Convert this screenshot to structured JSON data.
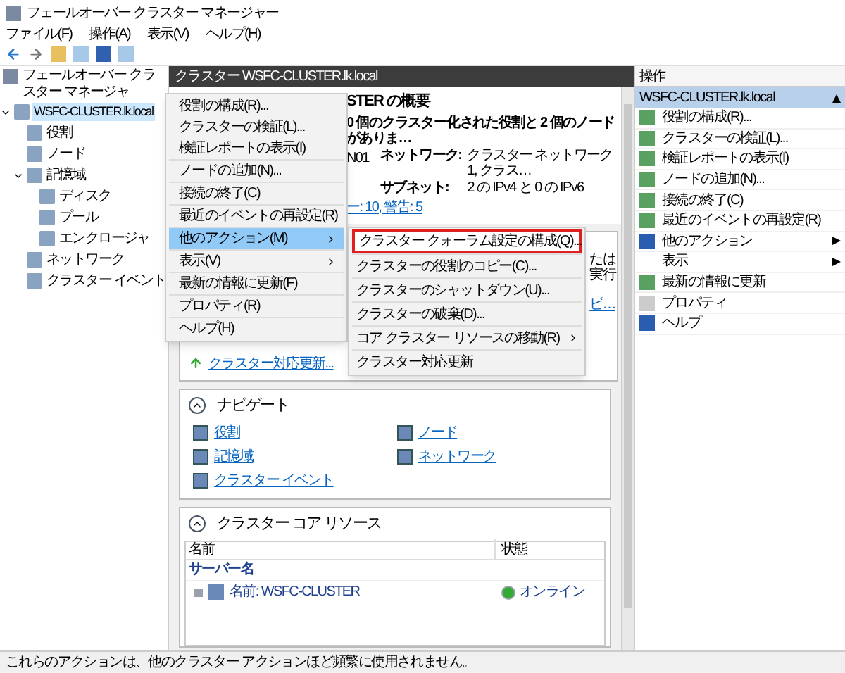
{
  "window": {
    "title": "フェールオーバー クラスター マネージャー"
  },
  "menu_bar": [
    "ファイル(F)",
    "操作(A)",
    "表示(V)",
    "ヘルプ(H)"
  ],
  "tree": {
    "root": "フェールオーバー クラスター マネージャ",
    "items": [
      {
        "label": "WSFC-CLUSTER.lk.local",
        "selected": true,
        "expanded": true,
        "children": [
          {
            "label": "役割",
            "selected": false
          },
          {
            "label": "ノード",
            "selected": false
          },
          {
            "label": "記憶域",
            "selected": false,
            "expanded": true,
            "children": [
              {
                "label": "ディスク",
                "selected": false
              },
              {
                "label": "プール",
                "selected": false
              },
              {
                "label": "エンクロージャ",
                "selected": false
              }
            ]
          },
          {
            "label": "ネットワーク",
            "selected": false
          },
          {
            "label": "クラスター イベント",
            "selected": false
          }
        ]
      }
    ]
  },
  "center": {
    "header": "クラスター WSFC-CLUSTER.lk.local",
    "summary": {
      "title_fragment": "STER の概要",
      "line": "0 個のクラスター化された役割と 2 個のノードがありま…",
      "network_label": "ネットワーク:",
      "network_value": "クラスター ネットワーク 1, クラス…",
      "node_fragment": "N01",
      "subnet_label": "サブネット:",
      "subnet_value": "2 の IPv4 と 0 の IPv6",
      "events_link": "ー: 10, 警告: 5"
    },
    "config_box": {
      "fragment_1": "たは",
      "fragment_2": "実行",
      "link_fragment": "ビ…",
      "update_link": "クラスター対応更新..."
    },
    "navigate": {
      "title": "ナビゲート",
      "expanded": true,
      "links": [
        "役割",
        "ノード",
        "記憶域",
        "ネットワーク",
        "クラスター イベント"
      ]
    },
    "core": {
      "title": "クラスター コア リソース",
      "expanded": true,
      "columns": [
        "名前",
        "状態"
      ],
      "group": "サーバー名",
      "rows": [
        {
          "name": "名前: WSFC-CLUSTER",
          "status": "オンライン"
        }
      ]
    }
  },
  "actions": {
    "title": "操作",
    "section": "WSFC-CLUSTER.lk.local",
    "expanded": true,
    "items": [
      {
        "label": "役割の構成(R)...",
        "submenu": false
      },
      {
        "label": "クラスターの検証(L)...",
        "submenu": false
      },
      {
        "label": "検証レポートの表示(I)",
        "submenu": false
      },
      {
        "label": "ノードの追加(N)...",
        "submenu": false
      },
      {
        "label": "接続の終了(C)",
        "submenu": false
      },
      {
        "label": "最近のイベントの再設定(R)",
        "submenu": false
      },
      {
        "label": "他のアクション",
        "submenu": true
      },
      {
        "label": "表示",
        "submenu": true
      },
      {
        "label": "最新の情報に更新",
        "submenu": false
      },
      {
        "label": "プロパティ",
        "submenu": false
      },
      {
        "label": "ヘルプ",
        "submenu": false
      }
    ]
  },
  "context_menu": {
    "groups": [
      [
        {
          "label": "役割の構成(R)...",
          "selected": false,
          "submenu": false
        },
        {
          "label": "クラスターの検証(L)...",
          "selected": false,
          "submenu": false
        },
        {
          "label": "検証レポートの表示(I)",
          "selected": false,
          "submenu": false
        }
      ],
      [
        {
          "label": "ノードの追加(N)...",
          "selected": false,
          "submenu": false
        }
      ],
      [
        {
          "label": "接続の終了(C)",
          "selected": false,
          "submenu": false
        }
      ],
      [
        {
          "label": "最近のイベントの再設定(R)",
          "selected": false,
          "submenu": false
        }
      ],
      [
        {
          "label": "他のアクション(M)",
          "selected": true,
          "submenu": true
        }
      ],
      [
        {
          "label": "表示(V)",
          "selected": false,
          "submenu": true
        }
      ],
      [
        {
          "label": "最新の情報に更新(F)",
          "selected": false,
          "submenu": false
        }
      ],
      [
        {
          "label": "プロパティ(R)",
          "selected": false,
          "submenu": false
        }
      ],
      [
        {
          "label": "ヘルプ(H)",
          "selected": false,
          "submenu": false
        }
      ]
    ]
  },
  "submenu": {
    "items": [
      {
        "label": "クラスター クォーラム設定の構成(Q)...",
        "outlined": true,
        "submenu": false
      },
      {
        "label": "クラスターの役割のコピー(C)...",
        "outlined": false,
        "submenu": false
      },
      {
        "label": "クラスターのシャットダウン(U)...",
        "outlined": false,
        "submenu": false
      },
      {
        "label": "クラスターの破棄(D)...",
        "outlined": false,
        "submenu": false
      },
      {
        "label": "コア クラスター リソースの移動(R)",
        "outlined": false,
        "submenu": true
      },
      {
        "label": "クラスター対応更新",
        "outlined": false,
        "submenu": false
      }
    ]
  },
  "status_bar": "これらのアクションは、他のクラスター アクションほど頻繁に使用されません。"
}
